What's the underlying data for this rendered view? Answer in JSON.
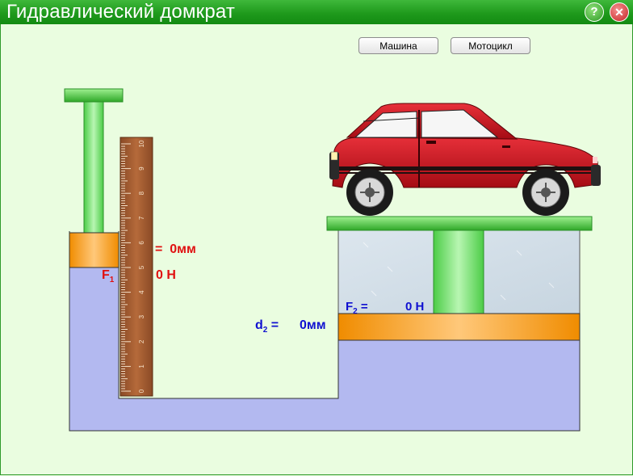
{
  "window": {
    "title": "Гидравлический домкрат",
    "help_label": "?",
    "close_label": "✕",
    "help_icon": "question-icon",
    "close_icon": "close-icon"
  },
  "toolbar": {
    "car_button": "Машина",
    "motorcycle_button": "Мотоцикл"
  },
  "small_piston": {
    "displacement_eq": "=",
    "displacement_value": "0мм",
    "force_label": "F",
    "force_subscript": "1",
    "force_value": "0 Н"
  },
  "large_piston": {
    "displacement_label": "d",
    "displacement_subscript": "2",
    "displacement_eq": "=",
    "displacement_value": "0мм",
    "force_label": "F",
    "force_subscript": "2",
    "force_eq": "=",
    "force_value": "0 Н"
  },
  "ruler": {
    "ticks": [
      "0",
      "1",
      "2",
      "3",
      "4",
      "5",
      "6",
      "7",
      "8",
      "9",
      "10"
    ]
  },
  "colors": {
    "title_bar": "#1f9a1c",
    "fluid": "#b3b9f0",
    "piston": "#f5a020",
    "rod": "#7ee07a",
    "car_body": "#c8101a"
  }
}
